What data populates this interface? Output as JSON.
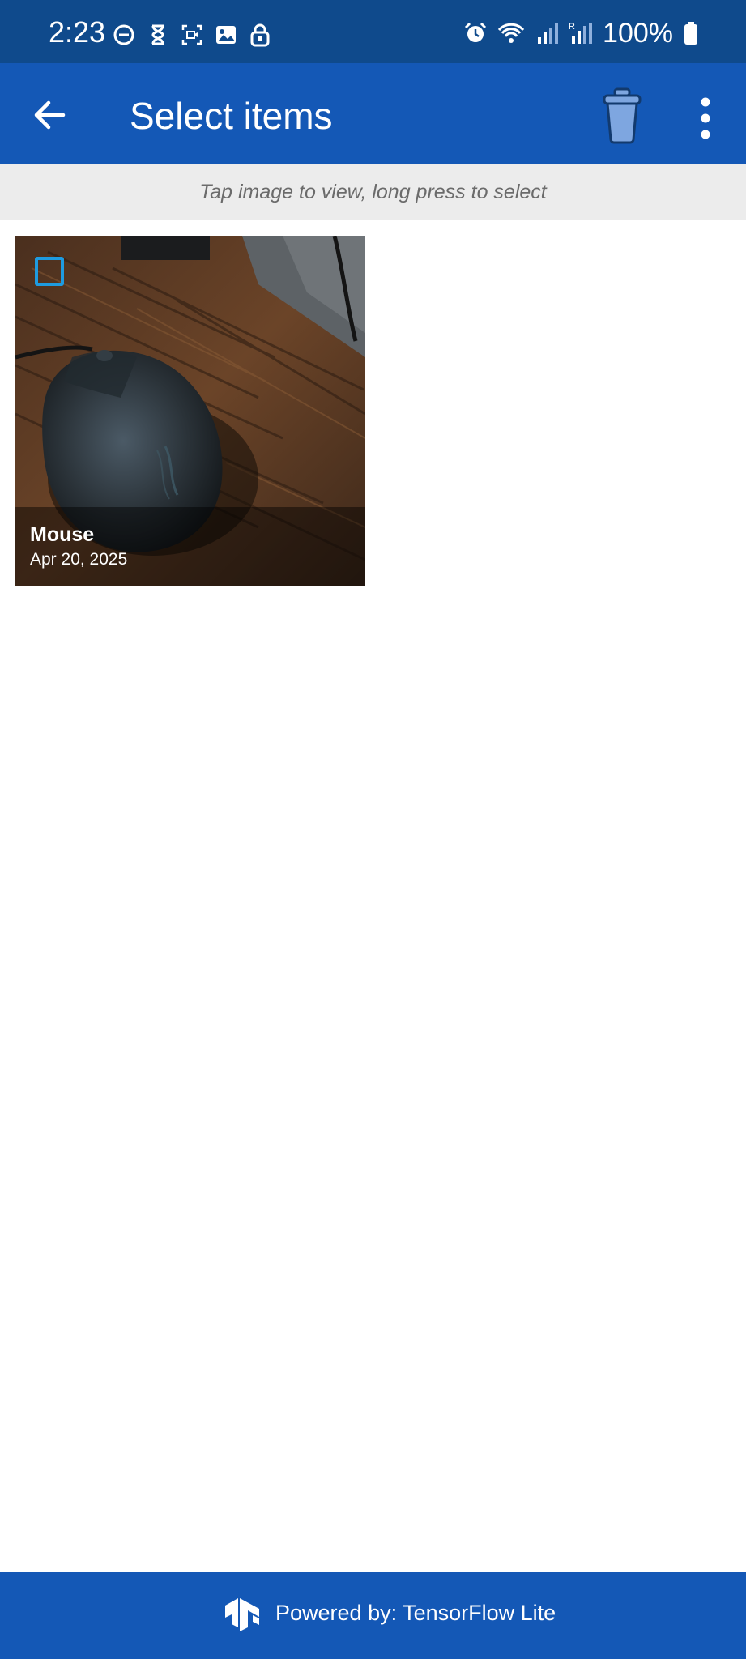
{
  "status_bar": {
    "time": "2:23",
    "battery_text": "100%",
    "left_icons": [
      "do-not-disturb-icon",
      "hourglass-icon",
      "screen-record-icon",
      "gallery-icon",
      "lock-icon"
    ],
    "right_icons": [
      "alarm-icon",
      "wifi-icon",
      "signal-icon",
      "roaming-signal-icon",
      "battery-icon"
    ]
  },
  "app_bar": {
    "title": "Select items",
    "back_icon": "arrow-back-icon",
    "delete_icon": "trash-icon",
    "more_icon": "more-vert-icon"
  },
  "hint": {
    "text": "Tap image to view, long press to select"
  },
  "items": [
    {
      "title": "Mouse",
      "date": "Apr 20, 2025",
      "selected": false
    }
  ],
  "footer": {
    "text": "Powered by: TensorFlow Lite",
    "logo_icon": "tensorflow-logo-icon"
  },
  "colors": {
    "status_bar": "#0f4a8c",
    "app_bar": "#1458b6",
    "hint_bar": "#ececec",
    "checkbox": "#1e9be0"
  }
}
